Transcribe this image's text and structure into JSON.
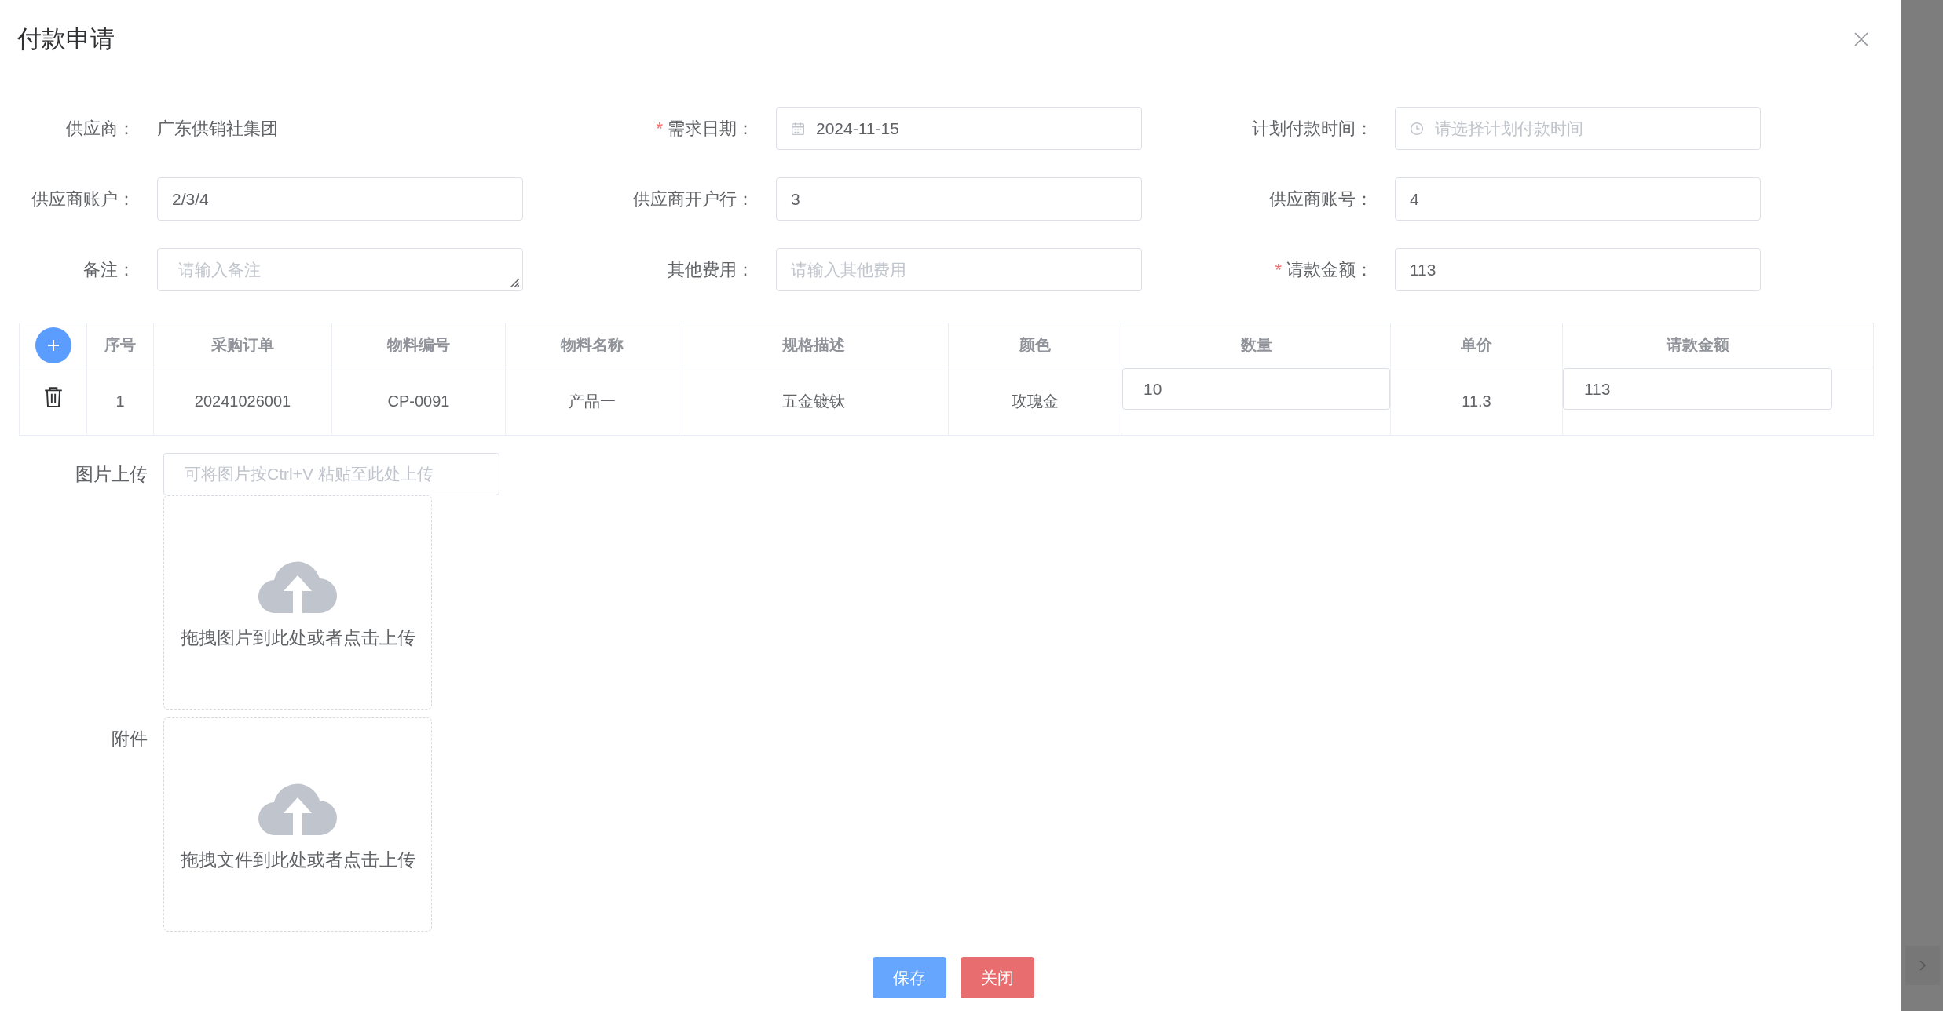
{
  "dialog": {
    "title": "付款申请"
  },
  "form": {
    "fields": [
      {
        "label": "供应商：",
        "kind": "static",
        "value": "广东供销社集团"
      },
      {
        "label": "需求日期：",
        "required_mark": "*",
        "kind": "date",
        "value": "2024-11-15"
      },
      {
        "label": "计划付款时间：",
        "kind": "time",
        "placeholder": "请选择计划付款时间"
      },
      {
        "label": "供应商账户：",
        "kind": "input",
        "value": "2/3/4"
      },
      {
        "label": "供应商开户行：",
        "kind": "input",
        "value": "3"
      },
      {
        "label": "供应商账号：",
        "kind": "input",
        "value": "4"
      },
      {
        "label": "备注：",
        "kind": "textarea",
        "placeholder": "请输入备注"
      },
      {
        "label": "其他费用：",
        "kind": "input",
        "placeholder": "请输入其他费用"
      },
      {
        "label": "请款金额：",
        "required_mark": "*",
        "kind": "input",
        "value": "113"
      }
    ]
  },
  "table": {
    "columns": [
      "序号",
      "采购订单",
      "物料编号",
      "物料名称",
      "规格描述",
      "颜色",
      "数量",
      "单价",
      "请款金额"
    ],
    "rows": [
      {
        "cells": [
          {
            "kind": "text",
            "value": "1"
          },
          {
            "kind": "text",
            "value": "20241026001"
          },
          {
            "kind": "text",
            "value": "CP-0091"
          },
          {
            "kind": "text",
            "value": "产品一"
          },
          {
            "kind": "text",
            "value": "五金镀钛"
          },
          {
            "kind": "text",
            "value": "玫瑰金"
          },
          {
            "kind": "input",
            "value": "10"
          },
          {
            "kind": "text",
            "value": "11.3"
          },
          {
            "kind": "input",
            "value": "113"
          }
        ]
      }
    ]
  },
  "image_upload": {
    "label": "图片上传",
    "paste_placeholder": "可将图片按Ctrl+V 粘贴至此处上传",
    "drop_hint": "拖拽图片到此处或者点击上传"
  },
  "attachment": {
    "label": "附件",
    "drop_hint": "拖拽文件到此处或者点击上传"
  },
  "buttons": [
    {
      "label": "保存",
      "kind": "primary"
    },
    {
      "label": "关闭",
      "kind": "danger"
    }
  ]
}
